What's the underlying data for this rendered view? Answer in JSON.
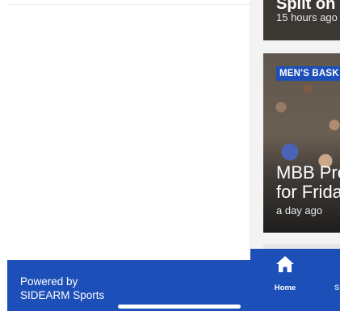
{
  "drawer": {
    "footer": {
      "powered_by_line1": "Powered by",
      "powered_by_line2": "SIDEARM Sports"
    }
  },
  "main": {
    "cards": [
      {
        "title": "Split on",
        "time": "15 hours ago"
      },
      {
        "badge": "MEN'S BASK",
        "headline": "MBB Pre\nfor Frida",
        "time": "a day ago"
      }
    ]
  },
  "bottom_nav": {
    "items": [
      {
        "label": "Home",
        "icon": "home-icon"
      },
      {
        "label": "S"
      }
    ]
  },
  "colors": {
    "brand_blue": "#1d4fb8"
  }
}
